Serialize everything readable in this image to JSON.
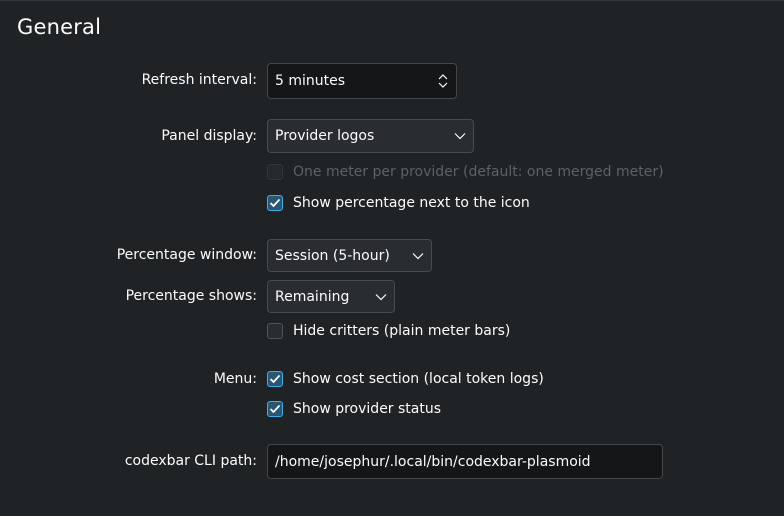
{
  "section": {
    "title": "General"
  },
  "refresh": {
    "label": "Refresh interval:",
    "value": "5 minutes"
  },
  "panel": {
    "label": "Panel display:",
    "value": "Provider logos",
    "one_meter": {
      "label": "One meter per provider (default: one merged meter)",
      "checked": false,
      "enabled": false
    },
    "show_percentage": {
      "label": "Show percentage next to the icon",
      "checked": true
    }
  },
  "percentage_window": {
    "label": "Percentage window:",
    "value": "Session (5-hour)"
  },
  "percentage_shows": {
    "label": "Percentage shows:",
    "value": "Remaining",
    "hide_critters": {
      "label": "Hide critters (plain meter bars)",
      "checked": false
    }
  },
  "menu": {
    "label": "Menu:",
    "cost_section": {
      "label": "Show cost section (local token logs)",
      "checked": true
    },
    "provider_status": {
      "label": "Show provider status",
      "checked": true
    }
  },
  "cli": {
    "label": "codexbar CLI path:",
    "value": "/home/josephur/.local/bin/codexbar-plasmoid"
  },
  "colors": {
    "accent": "#3daee9",
    "background": "#202326",
    "field": "#141618"
  }
}
